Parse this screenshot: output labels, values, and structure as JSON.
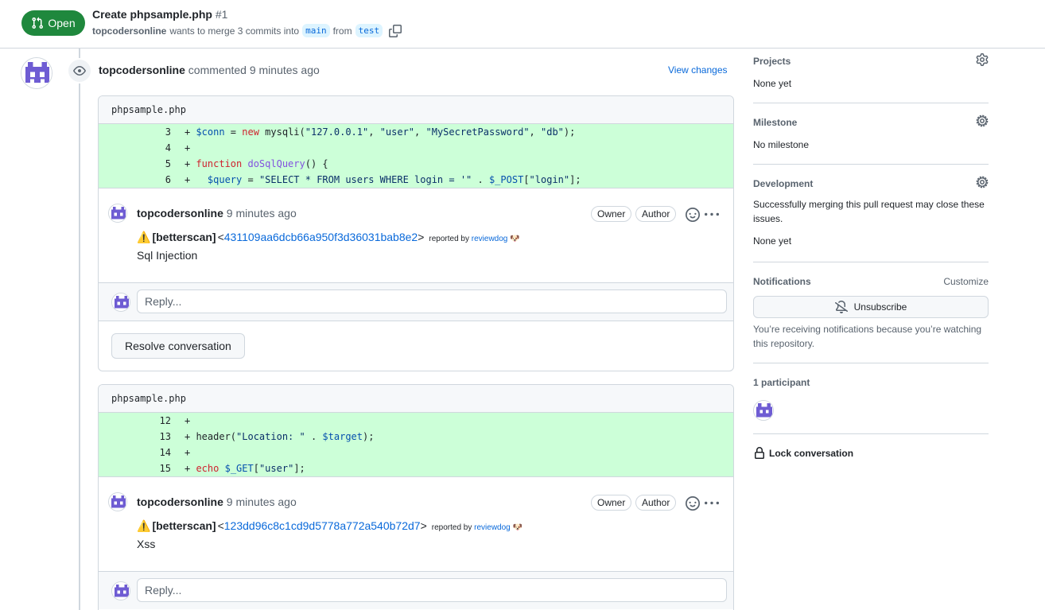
{
  "header": {
    "state": "Open",
    "title": "Create phpsample.php",
    "number": "#1",
    "author": "topcodersonline",
    "merge_text": "wants to merge 3 commits into",
    "base_branch": "main",
    "from_text": "from",
    "head_branch": "test"
  },
  "review": {
    "author": "topcodersonline",
    "action": "commented",
    "time": "9 minutes ago",
    "view_changes": "View changes"
  },
  "threads": [
    {
      "file": "phpsample.php",
      "lines": [
        {
          "num": "3",
          "code": "+ $conn = new mysqli(\"127.0.0.1\", \"user\", \"MySecretPassword\", \"db\");"
        },
        {
          "num": "4",
          "code": "+"
        },
        {
          "num": "5",
          "code": "+ function doSqlQuery() {"
        },
        {
          "num": "6",
          "code": "+   $query = \"SELECT * FROM users WHERE login = '\" . $_POST[\"login\"];"
        }
      ],
      "comment": {
        "author": "topcodersonline",
        "time": "9 minutes ago",
        "owner": "Owner",
        "role_author": "Author",
        "emoji": "⚠️",
        "tag": "[betterscan]",
        "sha": "431109aa6dcb66a950f3d36031bab8e2",
        "reported_by": "reported by",
        "reporter": "reviewdog",
        "reporter_emoji": "🐶",
        "text": "Sql Injection"
      },
      "reply_placeholder": "Reply...",
      "resolve": "Resolve conversation"
    },
    {
      "file": "phpsample.php",
      "lines": [
        {
          "num": "12",
          "code": "+"
        },
        {
          "num": "13",
          "code": "+ header(\"Location: \" . $target);"
        },
        {
          "num": "14",
          "code": "+"
        },
        {
          "num": "15",
          "code": "+ echo $_GET[\"user\"];"
        }
      ],
      "comment": {
        "author": "topcodersonline",
        "time": "9 minutes ago",
        "owner": "Owner",
        "role_author": "Author",
        "emoji": "⚠️",
        "tag": "[betterscan]",
        "sha": "123dd96c8c1cd9d5778a772a540b72d7",
        "reported_by": "reported by",
        "reporter": "reviewdog",
        "reporter_emoji": "🐶",
        "text": "Xss"
      },
      "reply_placeholder": "Reply..."
    }
  ],
  "sidebar": {
    "projects_title": "Projects",
    "projects_value": "None yet",
    "milestone_title": "Milestone",
    "milestone_value": "No milestone",
    "development_title": "Development",
    "development_text": "Successfully merging this pull request may close these issues.",
    "development_value": "None yet",
    "notifications_title": "Notifications",
    "customize": "Customize",
    "unsubscribe": "Unsubscribe",
    "notif_text": "You’re receiving notifications because you’re watching this repository.",
    "participants": "1 participant",
    "lock": "Lock conversation"
  },
  "colors": {
    "open_green": "#1f883d",
    "diff_add": "#ccffd8",
    "link_blue": "#0969da",
    "avatar_purple": "#6e5cd3"
  }
}
